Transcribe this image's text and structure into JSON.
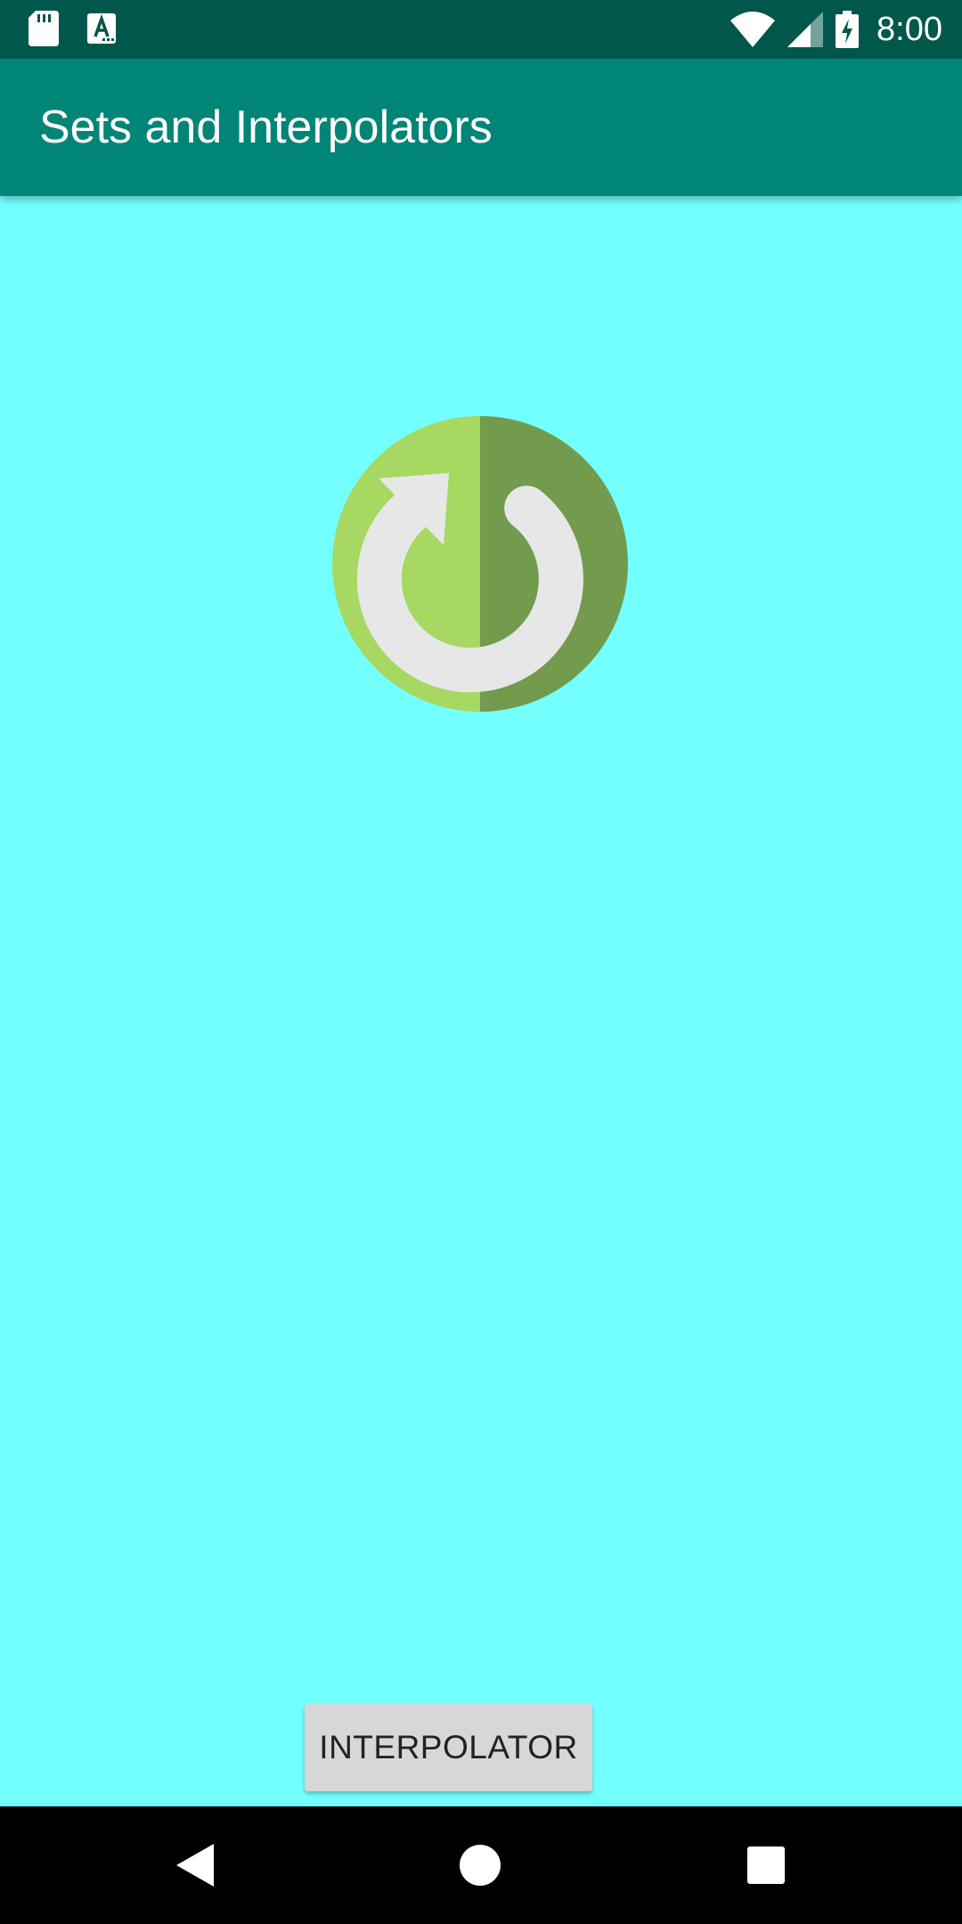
{
  "status_bar": {
    "time": "8:00",
    "icons": [
      "sd-card-icon",
      "text-a-icon",
      "wifi-icon",
      "cell-signal-icon",
      "battery-charging-icon"
    ]
  },
  "app_bar": {
    "title": "Sets and Interpolators"
  },
  "main": {
    "image_icon": "rotate-refresh-icon",
    "button_label": "INTERPOLATOR"
  },
  "nav_bar": {
    "icons": [
      "back-icon",
      "home-icon",
      "recents-icon"
    ]
  },
  "colors": {
    "status_bar": "#00574B",
    "app_bar": "#008577",
    "background": "#74FFFF",
    "icon_light_green": "#A6D862",
    "icon_dark_green": "#729B4E",
    "icon_arrow": "#E7E7E7",
    "button": "#D6D7D7"
  }
}
